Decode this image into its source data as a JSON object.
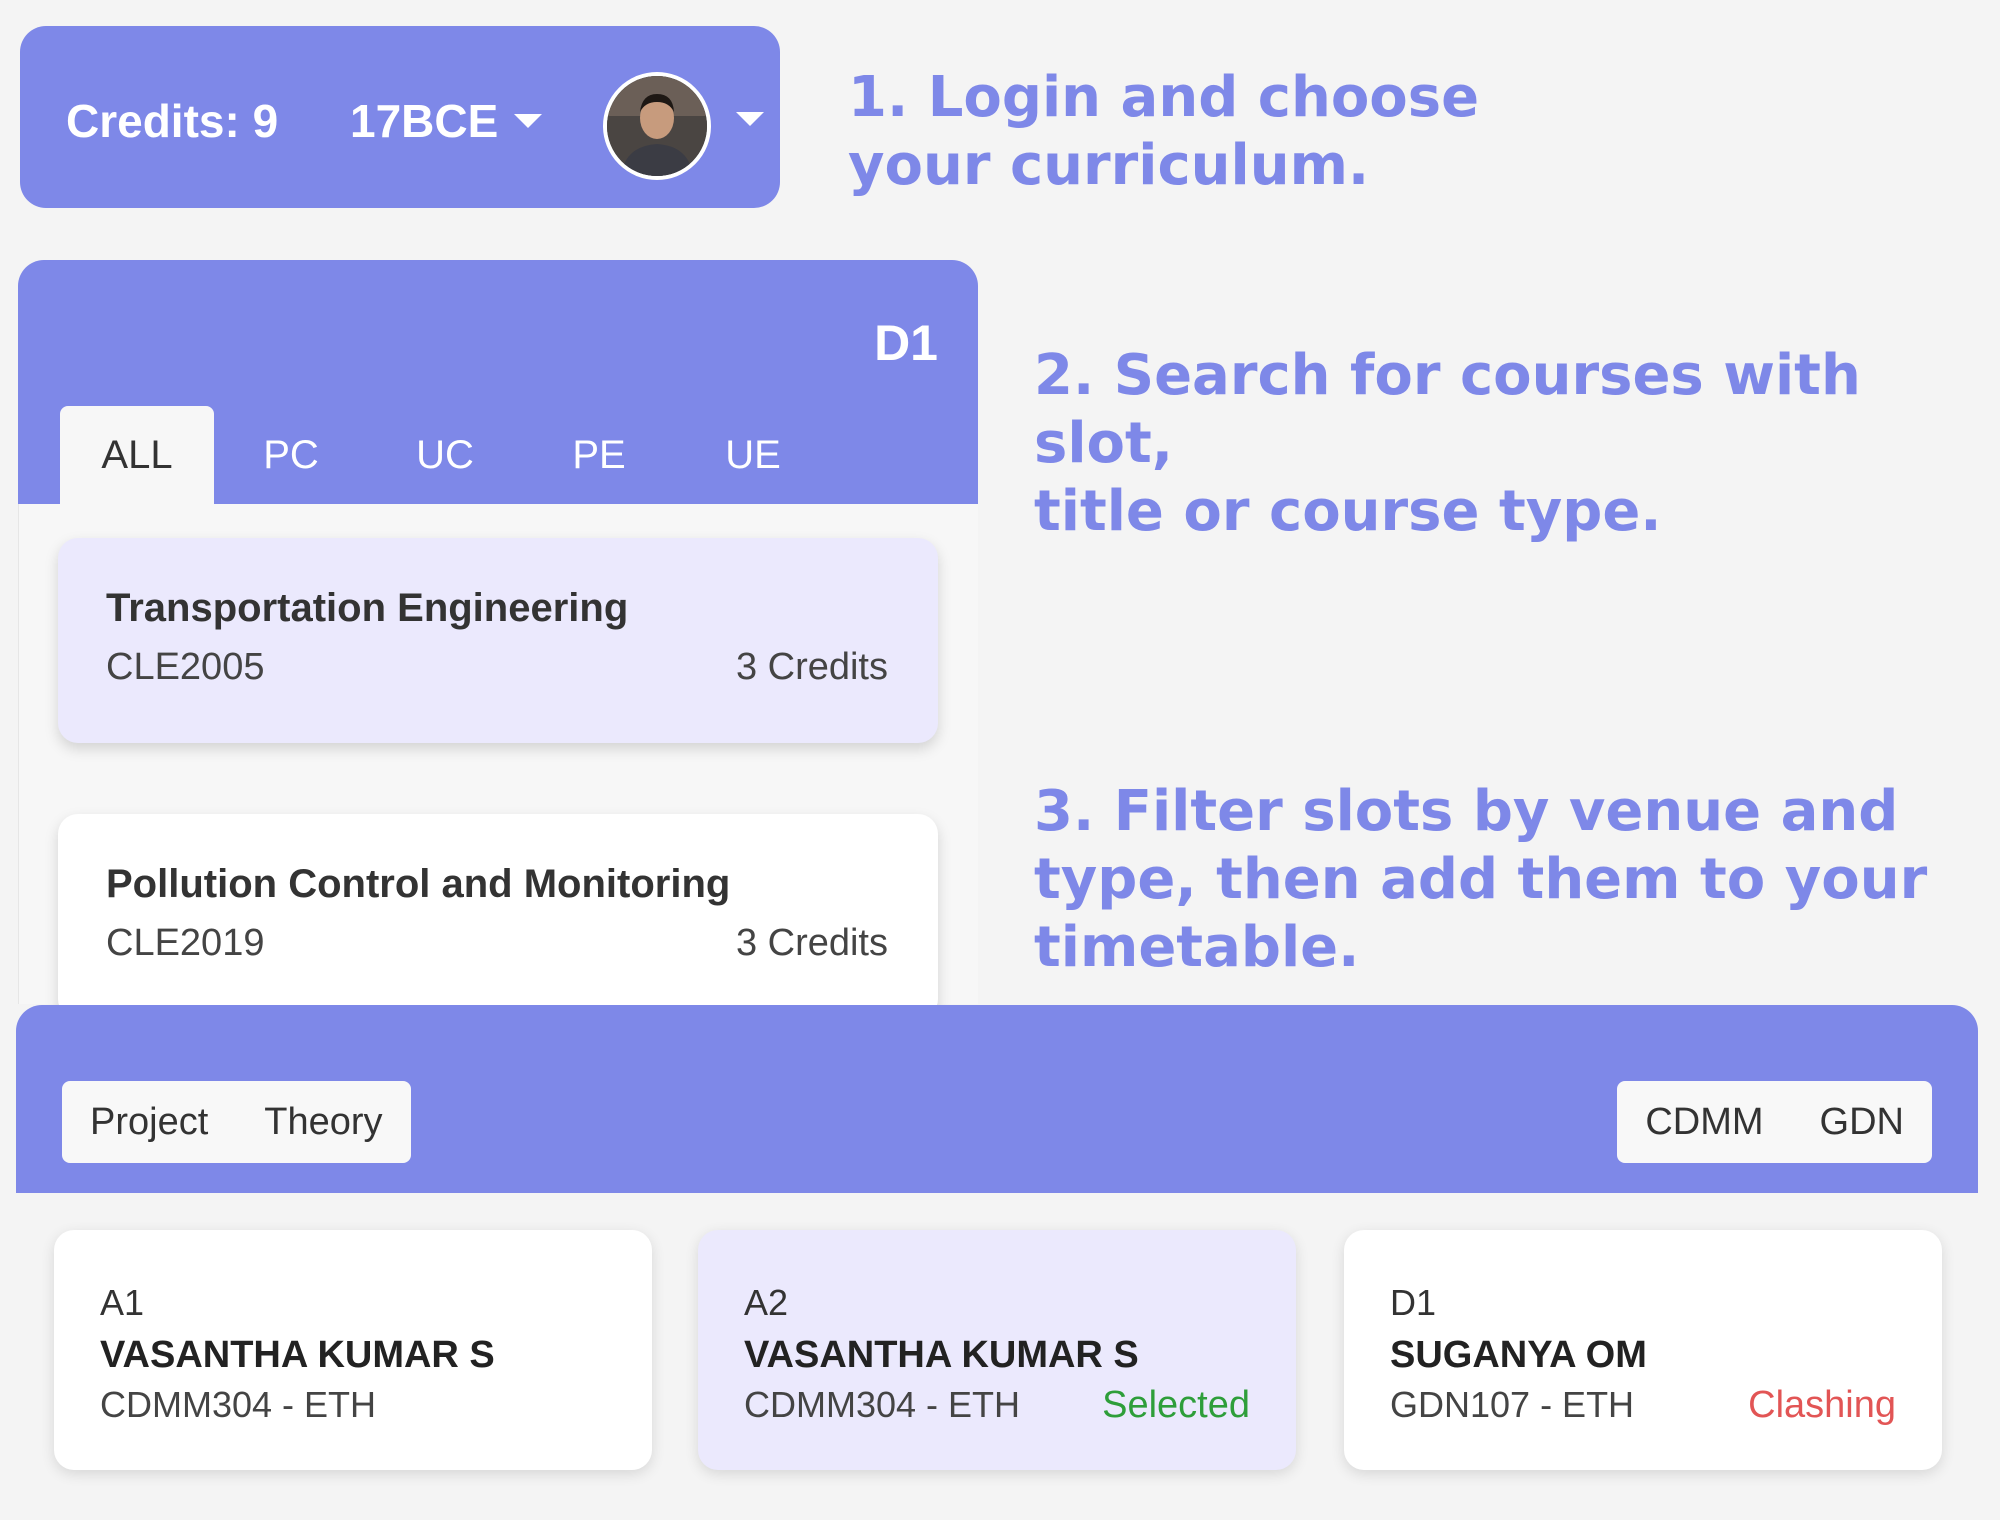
{
  "topbar": {
    "credits": "Credits: 9",
    "curriculum": "17BCE",
    "avatar_alt": "user avatar"
  },
  "steps": {
    "step1": "1. Login and choose your curriculum.",
    "step1_l1": "1. Login and choose",
    "step1_l2": "your curriculum.",
    "step2_l1": "2. Search for courses with slot,",
    "step2_l2": "title or course type.",
    "step3_l1": "3. Filter slots by venue and",
    "step3_l2": "type, then add them to your",
    "step3_l3": "timetable."
  },
  "search": {
    "slot": "D1",
    "tabs": [
      "ALL",
      "PC",
      "UC",
      "PE",
      "UE"
    ],
    "active_tab": "ALL",
    "courses": [
      {
        "title": "Transportation Engineering",
        "code": "CLE2005",
        "credits": "3 Credits",
        "selected": true
      },
      {
        "title": "Pollution Control and Monitoring",
        "code": "CLE2019",
        "credits": "3 Credits",
        "selected": false
      }
    ]
  },
  "slots": {
    "type_filters": [
      "Project",
      "Theory"
    ],
    "venue_filters": [
      "CDMM",
      "GDN"
    ],
    "cards": [
      {
        "slot": "A1",
        "faculty": "VASANTHA KUMAR S",
        "venue": "CDMM304 - ETH",
        "status": ""
      },
      {
        "slot": "A2",
        "faculty": "VASANTHA KUMAR S",
        "venue": "CDMM304 - ETH",
        "status": "Selected"
      },
      {
        "slot": "D1",
        "faculty": "SUGANYA OM",
        "venue": "GDN107 - ETH",
        "status": "Clashing"
      }
    ]
  },
  "colors": {
    "accent": "#7e88e8",
    "selected_bg": "#ebe9fd",
    "status_selected": "#2e9e3a",
    "status_clashing": "#e25555"
  }
}
